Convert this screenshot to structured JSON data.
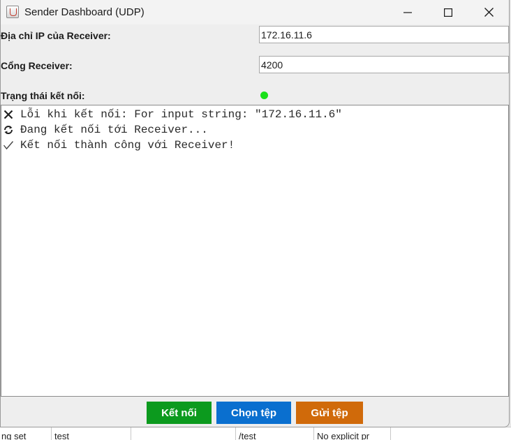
{
  "window": {
    "title": "Sender Dashboard (UDP)"
  },
  "form": {
    "ip_label": "Địa chỉ IP của Receiver:",
    "ip_value": "172.16.11.6",
    "port_label": "Cổng Receiver:",
    "port_value": "4200",
    "status_label": "Trạng thái kết nối:",
    "status_color": "#19e019"
  },
  "log": {
    "lines": [
      {
        "icon": "close-icon",
        "text": "Lỗi khi kết nối: For input string: \"172.16.11.6\""
      },
      {
        "icon": "refresh-icon",
        "text": "Đang kết nối tới Receiver..."
      },
      {
        "icon": "checkmark-icon",
        "text": "Kết nối thành công với Receiver!"
      }
    ]
  },
  "buttons": {
    "connect": {
      "label": "Kết nối",
      "color": "#0c9a1e"
    },
    "choose_file": {
      "label": "Chọn tệp",
      "color": "#0a6fcf"
    },
    "send_file": {
      "label": "Gửi tệp",
      "color": "#d06a0a"
    }
  },
  "background_table": {
    "cells": [
      "ng set",
      "test",
      "",
      "/test",
      "No explicit pr"
    ]
  }
}
